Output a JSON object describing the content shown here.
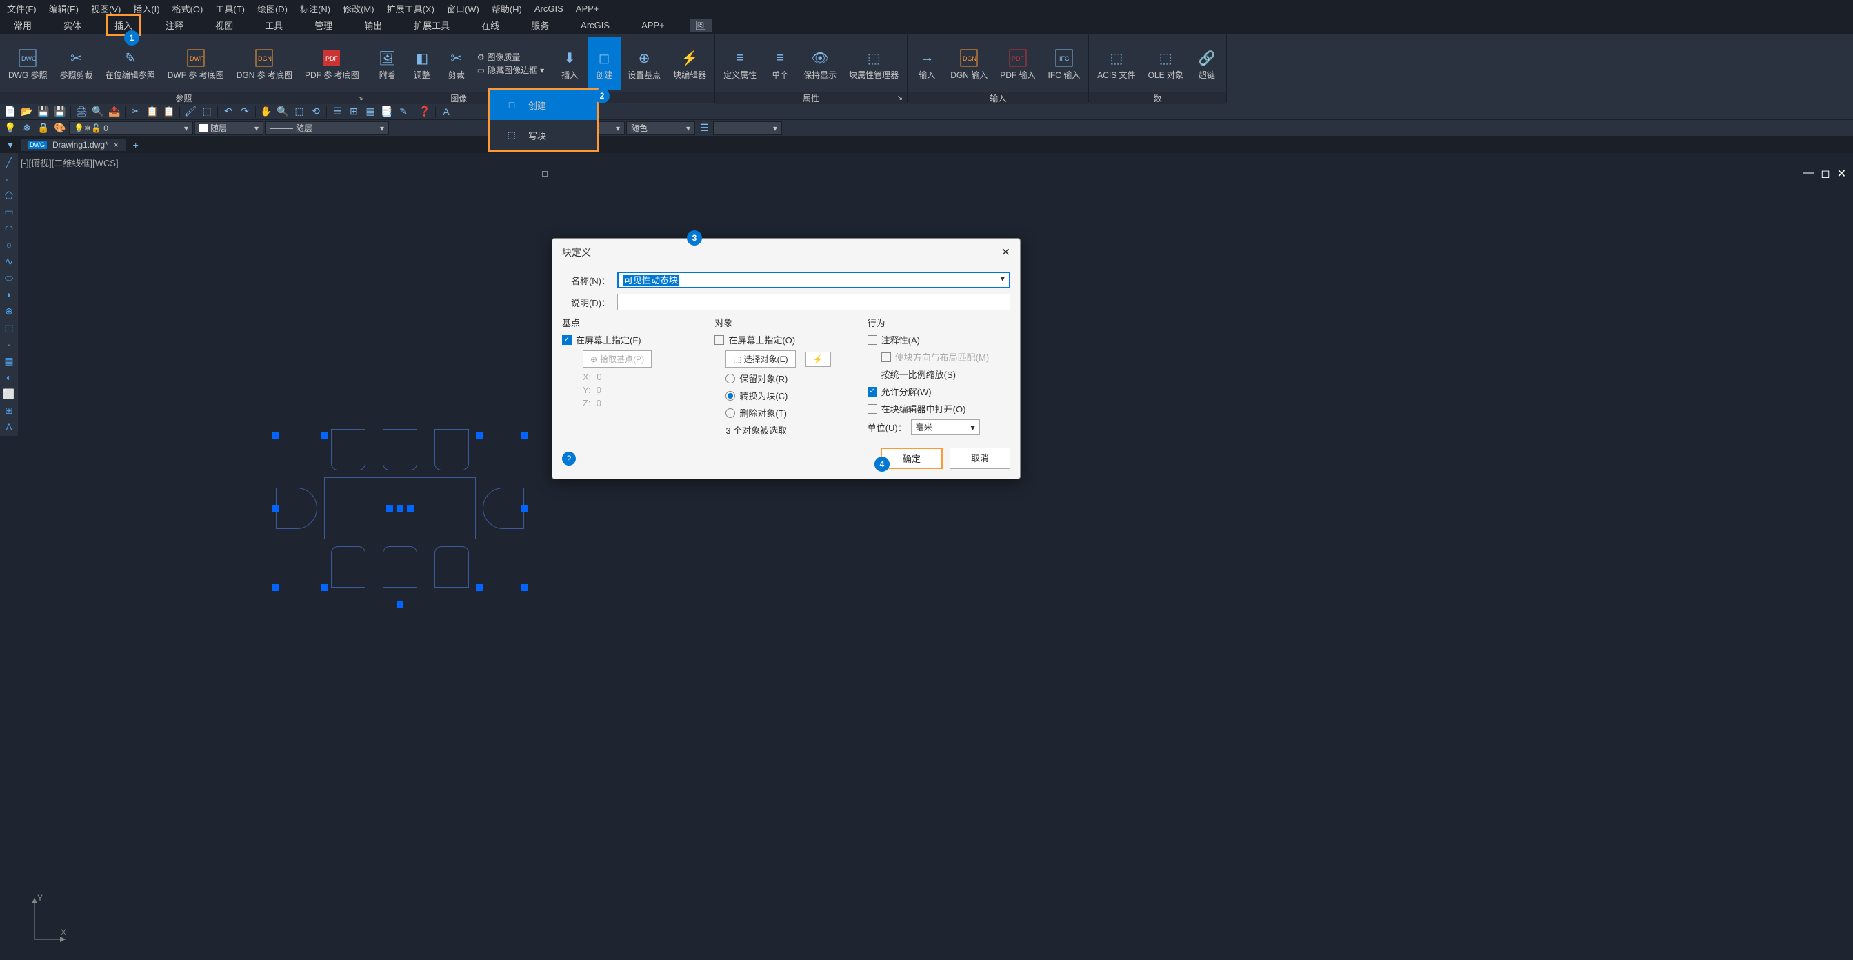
{
  "menubar": [
    "文件(F)",
    "编辑(E)",
    "视图(V)",
    "插入(I)",
    "格式(O)",
    "工具(T)",
    "绘图(D)",
    "标注(N)",
    "修改(M)",
    "扩展工具(X)",
    "窗口(W)",
    "帮助(H)",
    "ArcGIS",
    "APP+"
  ],
  "tabs": [
    "常用",
    "实体",
    "插入",
    "注释",
    "视图",
    "工具",
    "管理",
    "输出",
    "扩展工具",
    "在线",
    "服务",
    "ArcGIS",
    "APP+"
  ],
  "active_tab_index": 2,
  "ribbon": {
    "groups": [
      {
        "label": "参照",
        "items": [
          {
            "icon": "DWG",
            "text": "DWG\n参照"
          },
          {
            "icon": "↗",
            "text": "参照剪裁"
          },
          {
            "icon": "✎",
            "text": "在位编辑参照"
          },
          {
            "icon": "DWF",
            "text": "DWF 参\n考底图"
          },
          {
            "icon": "DGN",
            "text": "DGN 参\n考底图"
          },
          {
            "icon": "PDF",
            "text": "PDF 参\n考底图"
          }
        ]
      },
      {
        "label": "图像",
        "items": [
          {
            "icon": "🖼",
            "text": "附着"
          },
          {
            "icon": "◧",
            "text": "调整"
          },
          {
            "icon": "✂",
            "text": "剪裁"
          }
        ],
        "small_items": [
          "图像质量",
          "隐藏图像边框"
        ]
      },
      {
        "label": "",
        "items": [
          {
            "icon": "⬇",
            "text": "插入"
          },
          {
            "icon": "◻",
            "text": "创建",
            "active": true
          },
          {
            "icon": "⊕",
            "text": "设置基点"
          },
          {
            "icon": "⚡",
            "text": "块编辑器"
          }
        ]
      },
      {
        "label": "属性",
        "items": [
          {
            "icon": "≡",
            "text": "定义属性"
          },
          {
            "icon": "≡",
            "text": "单个"
          },
          {
            "icon": "👁",
            "text": "保持显示"
          },
          {
            "icon": "⬚",
            "text": "块属性管理器"
          }
        ]
      },
      {
        "label": "输入",
        "items": [
          {
            "icon": "→",
            "text": "输入"
          },
          {
            "icon": "DGN",
            "text": "DGN\n输入"
          },
          {
            "icon": "PDF",
            "text": "PDF\n输入"
          },
          {
            "icon": "IFC",
            "text": "IFC\n输入"
          }
        ]
      },
      {
        "label": "数",
        "items": [
          {
            "icon": "⬚",
            "text": "ACIS\n文件"
          },
          {
            "icon": "⬚",
            "text": "OLE\n对象"
          },
          {
            "icon": "🔗",
            "text": "超链"
          }
        ]
      }
    ]
  },
  "dropdown": {
    "items": [
      {
        "icon": "◻",
        "label": "创建",
        "active": true
      },
      {
        "icon": "⬚",
        "label": "写块"
      }
    ]
  },
  "toolbar2_combos": [
    "随层",
    "随层",
    "随层",
    "随色"
  ],
  "doc_tab": {
    "badge": "DWG",
    "name": "Drawing1.dwg*"
  },
  "viewport_label": "[-][俯视][二维线框][WCS]",
  "dialog": {
    "title": "块定义",
    "name_label": "名称(N)：",
    "name_value": "可见性动态块",
    "desc_label": "说明(D)：",
    "desc_value": "",
    "groups": {
      "base": {
        "title": "基点",
        "specify_on_screen": "在屏幕上指定(F)",
        "specify_checked": true,
        "pick_btn": "拾取基点(P)",
        "x": "0",
        "y": "0",
        "z": "0"
      },
      "objects": {
        "title": "对象",
        "specify_on_screen": "在屏幕上指定(O)",
        "specify_checked": false,
        "select_btn": "选择对象(E)",
        "retain": "保留对象(R)",
        "convert": "转换为块(C)",
        "delete": "删除对象(T)",
        "selected_radio": "convert",
        "count_text": "3 个对象被选取"
      },
      "behavior": {
        "title": "行为",
        "annotative": "注释性(A)",
        "match_orient": "使块方向与布局匹配(M)",
        "uniform_scale": "按统一比例缩放(S)",
        "allow_explode": "允许分解(W)",
        "allow_explode_checked": true,
        "open_editor": "在块编辑器中打开(O)",
        "unit_label": "单位(U)：",
        "unit_value": "毫米"
      }
    },
    "ok": "确定",
    "cancel": "取消"
  },
  "callouts": {
    "1": "1",
    "2": "2",
    "3": "3",
    "4": "4"
  }
}
